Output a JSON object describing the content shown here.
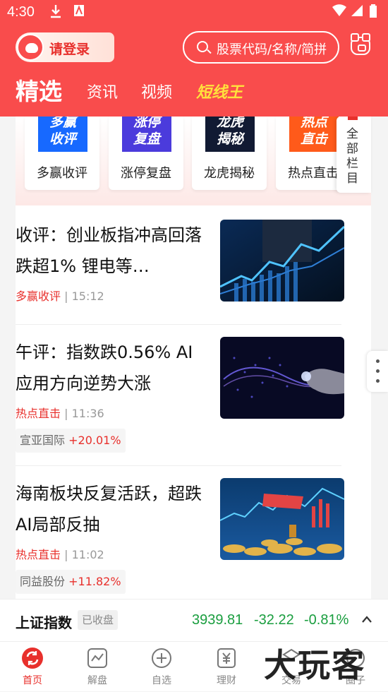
{
  "status_bar": {
    "time": "4:30"
  },
  "header": {
    "login_label": "请登录",
    "search_placeholder": "股票代码/名称/简拼",
    "tabs": [
      {
        "label": "精选",
        "active": true
      },
      {
        "label": "资讯"
      },
      {
        "label": "视频"
      },
      {
        "label": "短线王",
        "special": true
      }
    ]
  },
  "columns": {
    "items": [
      {
        "thumb_text": "多赢\n收评",
        "label": "多赢收评",
        "color": "#1769ff"
      },
      {
        "thumb_text": "涨停\n复盘",
        "label": "涨停复盘",
        "color": "#4b3bdc"
      },
      {
        "thumb_text": "龙虎\n揭秘",
        "label": "龙虎揭秘",
        "color": "#111a33"
      },
      {
        "thumb_text": "热点\n直击",
        "label": "热点直击",
        "color": "#ff5a1a"
      }
    ],
    "all_label": "全部栏目"
  },
  "news": [
    {
      "title": "收评：创业板指冲高回落跌超1% 锂电等…",
      "source": "多赢收评",
      "time": "| 15:12",
      "image": "business-chart-image"
    },
    {
      "title": "午评：指数跌0.56% AI应用方向逆势大涨",
      "source": "热点直击",
      "time": "| 11:36",
      "image": "ai-hand-image",
      "stock": {
        "name": "宣亚国际",
        "change": "+20.01%"
      }
    },
    {
      "title": "海南板块反复活跃，超跌AI局部反抽",
      "source": "热点直击",
      "time": "| 11:02",
      "image": "a-share-coins-image",
      "stock": {
        "name": "同益股份",
        "change": "+11.82%"
      }
    }
  ],
  "ticker": {
    "name": "上证指数",
    "status": "已收盘",
    "value": "3939.81",
    "change": "-32.22",
    "percent": "-0.81%",
    "color": "#1a9e3f"
  },
  "nav": [
    {
      "label": "首页",
      "icon": "home-icon",
      "active": true
    },
    {
      "label": "解盘",
      "icon": "chart-icon"
    },
    {
      "label": "自选",
      "icon": "add-circle-icon"
    },
    {
      "label": "理财",
      "icon": "yuan-icon"
    },
    {
      "label": "交易",
      "icon": "trade-icon"
    },
    {
      "label": "圈子",
      "icon": "community-icon"
    }
  ],
  "watermark": "大玩客",
  "colors": {
    "brand": "#f94c4c",
    "accent_red": "#e8302c",
    "down_green": "#1a9e3f"
  }
}
